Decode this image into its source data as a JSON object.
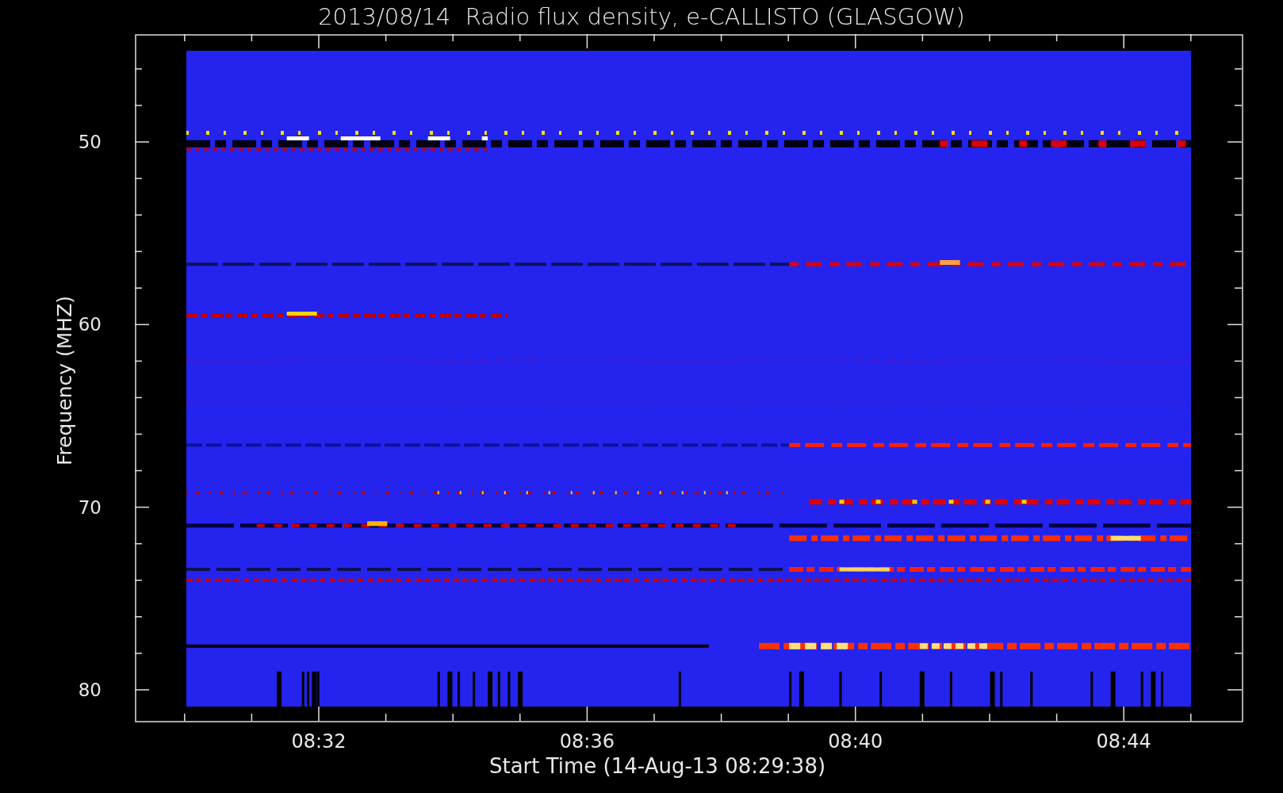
{
  "title": "2013/08/14  Radio flux density, e-CALLISTO (GLASGOW)",
  "plot": {
    "ylabel": "Frequency (MHZ)",
    "xlabel": "Start Time (14-Aug-13 08:29:38)",
    "y_ticks": [
      "50",
      "60",
      "70",
      "80"
    ],
    "x_ticks": [
      "08:32",
      "08:36",
      "08:40",
      "08:44"
    ]
  }
}
